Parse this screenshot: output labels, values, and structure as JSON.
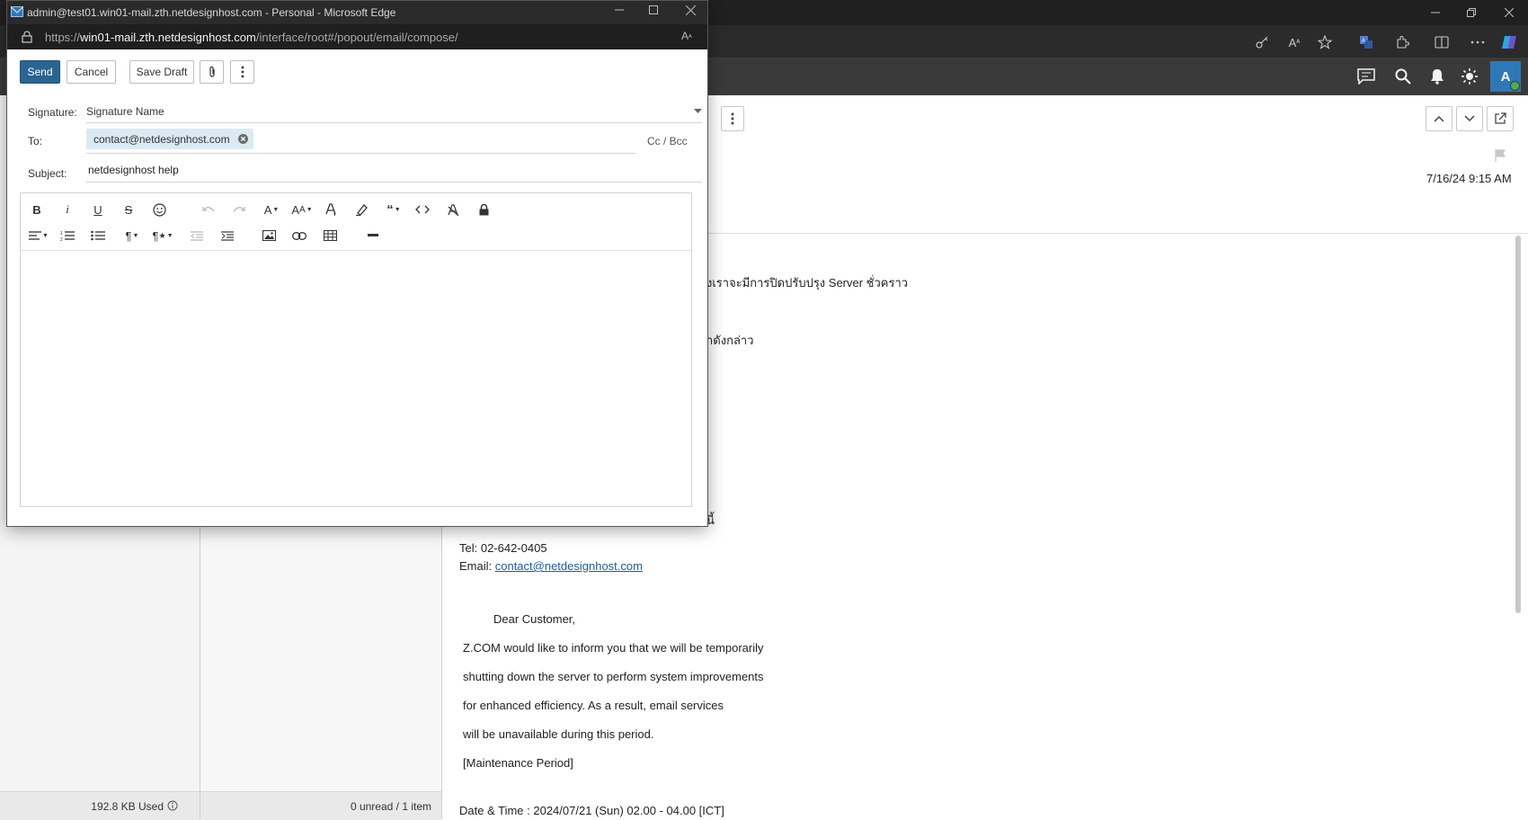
{
  "browser": {
    "toolbar_icons": [
      "key-icon",
      "read-aloud-icon",
      "favorite-star-icon",
      "translate-icon",
      "extensions-icon",
      "split-screen-icon",
      "more-icon",
      "copilot-icon"
    ]
  },
  "app_header": {
    "icons": [
      "chat-icon",
      "search-icon",
      "bell-icon",
      "theme-icon"
    ],
    "avatar_letter": "A",
    "status_color": "#4caf50"
  },
  "left_pane": {
    "storage_used": "192.8 KB Used"
  },
  "message_list": {
    "count_status": "0 unread / 1 item"
  },
  "reader": {
    "date": "7/16/24 9:15 AM",
    "thai_line_1": "งเราจะมีการปิดปรับปรุง Server ชั่วคราว",
    "thai_line_2": "าดังกล่าว",
    "thai_line_3": "นี้",
    "tel": "Tel: 02-642-0405",
    "email_label": "Email: ",
    "email_link": "contact@netdesignhost.com",
    "lines": [
      "Dear Customer,",
      "Z.COM would like to inform you that we will be temporarily",
      "shutting down the server to perform system improvements",
      "for enhanced efficiency. As a result, email services",
      "will be unavailable during this period.",
      "[Maintenance Period]",
      "Date & Time : 2024/07/21 (Sun) 02.00 - 04.00 [ICT]"
    ]
  },
  "popup": {
    "title": "admin@test01.win01-mail.zth.netdesignhost.com - Personal - Microsoft Edge",
    "url_prefix": "https://",
    "url_host": "win01-mail.zth.netdesignhost.com",
    "url_path": "/interface/root#/popout/email/compose/",
    "compose": {
      "send_label": "Send",
      "cancel_label": "Cancel",
      "save_draft_label": "Save Draft",
      "signature_label": "Signature:",
      "signature_value": "Signature Name",
      "to_label": "To:",
      "to_recipient": "contact@netdesignhost.com",
      "cc_bcc_label": "Cc / Bcc",
      "subject_label": "Subject:",
      "subject_value": "netdesignhost help",
      "body": ""
    }
  },
  "colors": {
    "accent": "#2a6592",
    "chip_bg": "#dbe9f3",
    "avatar_bg": "#2f78b8",
    "link": "#1a5f9e"
  }
}
